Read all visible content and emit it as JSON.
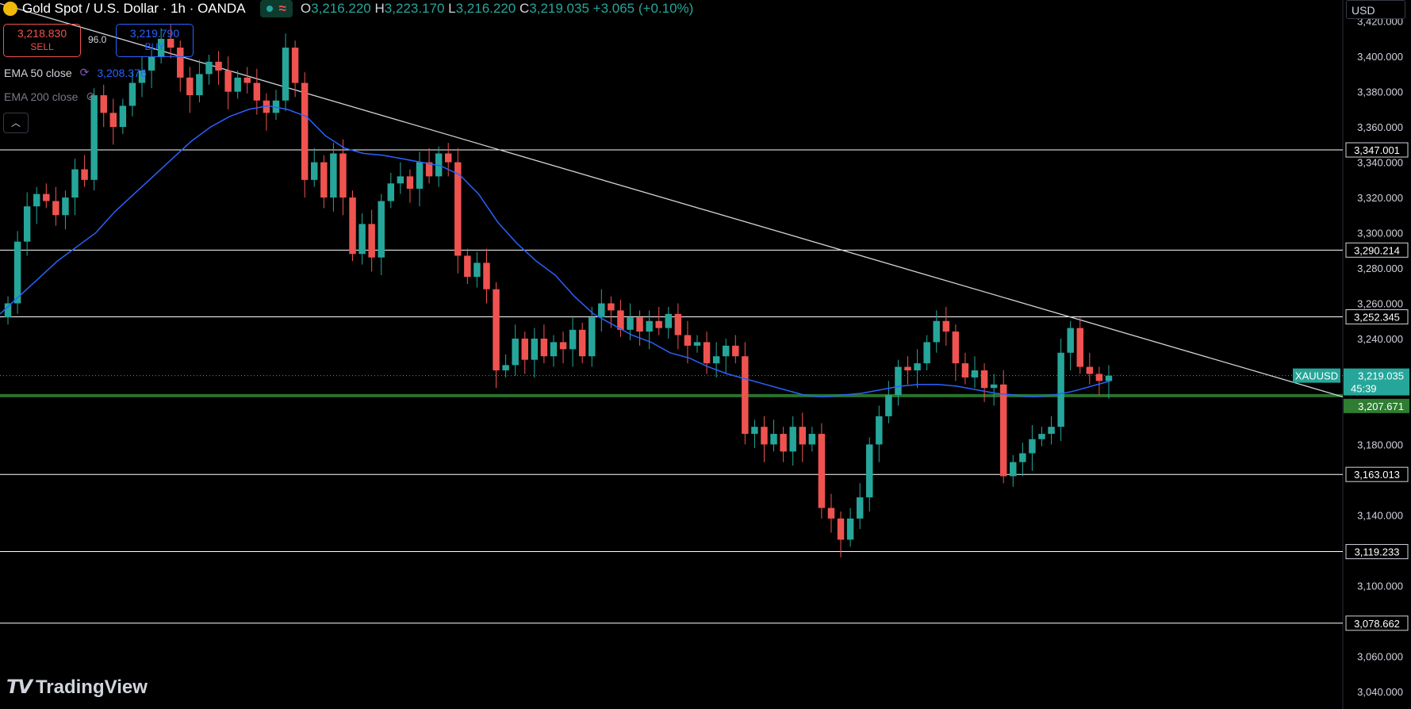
{
  "header": {
    "title": "Gold Spot / U.S. Dollar · 1h · OANDA",
    "ohlc": {
      "o_label": "O",
      "o": "3,216.220",
      "h_label": "H",
      "h": "3,223.170",
      "l_label": "L",
      "l": "3,216.220",
      "c_label": "C",
      "c": "3,219.035",
      "change": "+3.065 (+0.10%)"
    }
  },
  "trade": {
    "sell_price": "3,218.830",
    "sell_label": "SELL",
    "spread": "96.0",
    "buy_price": "3,219.790",
    "buy_label": "BUY"
  },
  "indicators": {
    "ema50_label": "EMA 50 close",
    "ema50_value": "3,208.376",
    "ema200_label": "EMA 200 close"
  },
  "currency": "USD",
  "branding": "TradingView",
  "colors": {
    "up": "#26a69a",
    "down": "#ef5350",
    "ema": "#2962ff",
    "level": "#ffffff",
    "support": "#2e7d32",
    "background": "#000000"
  },
  "chart_data": {
    "type": "candlestick",
    "symbol": "XAUUSD",
    "timeframe": "1h",
    "ylim": [
      3030,
      3432
    ],
    "y_ticks": [
      3040,
      3060,
      3100,
      3140,
      3180,
      3240,
      3260,
      3280,
      3300,
      3320,
      3340,
      3360,
      3380,
      3400,
      3420
    ],
    "y_tick_labels": [
      "3,040.000",
      "3,060.000",
      "3,100.000",
      "3,140.000",
      "3,180.000",
      "3,240.000",
      "3,260.000",
      "3,280.000",
      "3,300.000",
      "3,320.000",
      "3,340.000",
      "3,360.000",
      "3,380.000",
      "3,400.000",
      "3,420.000"
    ],
    "horizontal_levels": [
      3347.001,
      3290.214,
      3252.345,
      3163.013,
      3119.233,
      3078.662
    ],
    "horizontal_level_labels": [
      "3,347.001",
      "3,290.214",
      "3,252.345",
      "3,163.013",
      "3,119.233",
      "3,078.662"
    ],
    "support_level": 3207.671,
    "support_level_label": "3,207.671",
    "last_price": 3219.035,
    "last_price_label": "3,219.035",
    "countdown": "45:39",
    "trendline": {
      "start": [
        0,
        3430
      ],
      "end": [
        1.0,
        3207
      ]
    },
    "close_path": [
      3260,
      3295,
      3315,
      3322,
      3318,
      3310,
      3320,
      3336,
      3330,
      3378,
      3368,
      3360,
      3372,
      3385,
      3392,
      3400,
      3410,
      3405,
      3388,
      3378,
      3390,
      3397,
      3392,
      3380,
      3388,
      3385,
      3375,
      3368,
      3375,
      3405,
      3385,
      3330,
      3340,
      3320,
      3345,
      3320,
      3288,
      3305,
      3286,
      3318,
      3328,
      3332,
      3325,
      3340,
      3332,
      3345,
      3340,
      3287,
      3275,
      3283,
      3268,
      3222,
      3225,
      3240,
      3228,
      3240,
      3230,
      3238,
      3234,
      3245,
      3230,
      3252,
      3260,
      3256,
      3245,
      3252,
      3244,
      3250,
      3246,
      3254,
      3242,
      3236,
      3238,
      3226,
      3230,
      3236,
      3230,
      3186,
      3190,
      3180,
      3186,
      3176,
      3190,
      3180,
      3186,
      3144,
      3138,
      3126,
      3138,
      3150,
      3180,
      3196,
      3208,
      3224,
      3222,
      3226,
      3238,
      3250,
      3244,
      3226,
      3218,
      3222,
      3212,
      3214,
      3162,
      3170,
      3175,
      3183,
      3186,
      3190,
      3232,
      3246,
      3224,
      3220,
      3216,
      3219
    ],
    "candle_count": 116,
    "ema50_path": [
      3254,
      3264,
      3274,
      3284,
      3292,
      3300,
      3312,
      3322,
      3332,
      3342,
      3352,
      3360,
      3366,
      3370,
      3372,
      3370,
      3366,
      3355,
      3348,
      3345,
      3344,
      3342,
      3340,
      3338,
      3333,
      3322,
      3306,
      3294,
      3284,
      3276,
      3264,
      3254,
      3248,
      3242,
      3238,
      3232,
      3229,
      3224,
      3220,
      3217,
      3214,
      3211,
      3208,
      3207,
      3208,
      3209,
      3211,
      3213,
      3214,
      3214,
      3213,
      3211,
      3209,
      3208,
      3207,
      3208,
      3210,
      3213,
      3216
    ],
    "volume_labels": []
  }
}
